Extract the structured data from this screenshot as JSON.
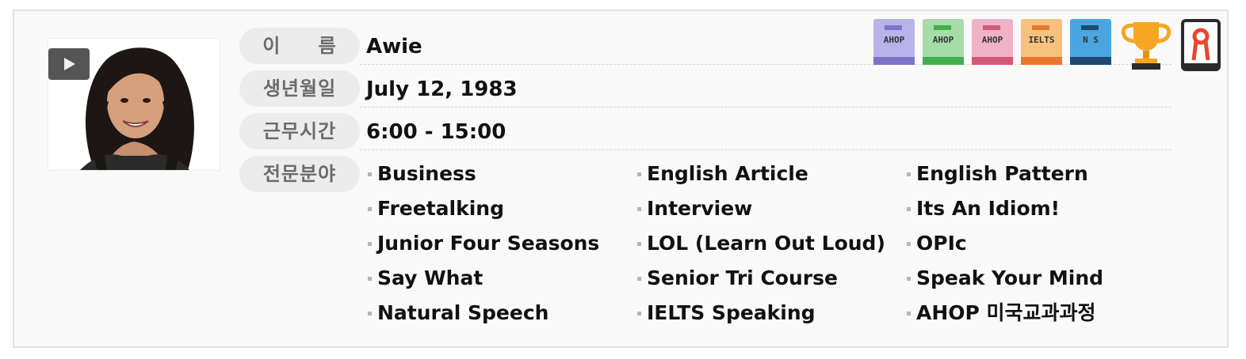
{
  "profile": {
    "labels": {
      "name": "이 름",
      "birthdate": "생년월일",
      "hours": "근무시간",
      "specialty": "전문분야"
    },
    "name": "Awie",
    "birthdate": "July 12, 1983",
    "hours": "6:00 - 15:00",
    "specialties": [
      "Business",
      "English Article",
      "English Pattern",
      "Freetalking",
      "Interview",
      "Its An Idiom!",
      "Junior Four Seasons",
      "LOL (Learn Out Loud)",
      "OPIc",
      "Say What",
      "Senior Tri Course",
      "Speak Your Mind",
      "Natural Speech",
      "IELTS Speaking",
      "AHOP 미국교과과정"
    ]
  },
  "badges": [
    {
      "text": "AHOP",
      "color": "#7b74c9",
      "light": "#b8b3e8",
      "icon": "book-icon"
    },
    {
      "text": "AHOP",
      "color": "#3fae4e",
      "light": "#a6dca8",
      "icon": "book-icon"
    },
    {
      "text": "AHOP",
      "color": "#d4567a",
      "light": "#f0b2c6",
      "icon": "book-icon"
    },
    {
      "text": "IELTS",
      "color": "#e8782f",
      "light": "#f7c27d",
      "icon": "book-icon"
    },
    {
      "text": "N S",
      "color": "#1e4a70",
      "light": "#4aa6e0",
      "icon": "book-icon"
    }
  ],
  "icons": {
    "play": "play-icon",
    "trophy": "trophy-icon",
    "medal": "medal-icon"
  },
  "colors": {
    "label_bg": "#ececec",
    "label_text": "#6b6b6b",
    "trophy": "#f5a623",
    "medal_border": "#2b2b2b",
    "medal_ribbon": "#e8452c"
  }
}
